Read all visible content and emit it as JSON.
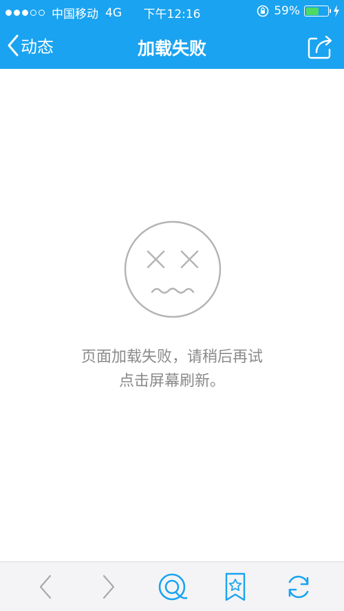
{
  "status_bar": {
    "carrier": "中国移动",
    "network": "4G",
    "time": "下午12:16",
    "battery_percent": "59%",
    "battery_level": 0.59,
    "signal_bars": 3,
    "signal_total": 5
  },
  "nav": {
    "back_label": "动态",
    "title": "加载失败"
  },
  "error": {
    "line1": "页面加载失败，请稍后再试",
    "line2": "点击屏幕刷新。"
  },
  "colors": {
    "accent": "#1aa3f0",
    "battery_fill": "#4cd964",
    "message_text": "#8a8a8a"
  },
  "toolbar": {
    "icons": [
      "back-arrow-icon",
      "forward-arrow-icon",
      "browser-home-icon",
      "bookmark-star-icon",
      "refresh-icon"
    ]
  }
}
